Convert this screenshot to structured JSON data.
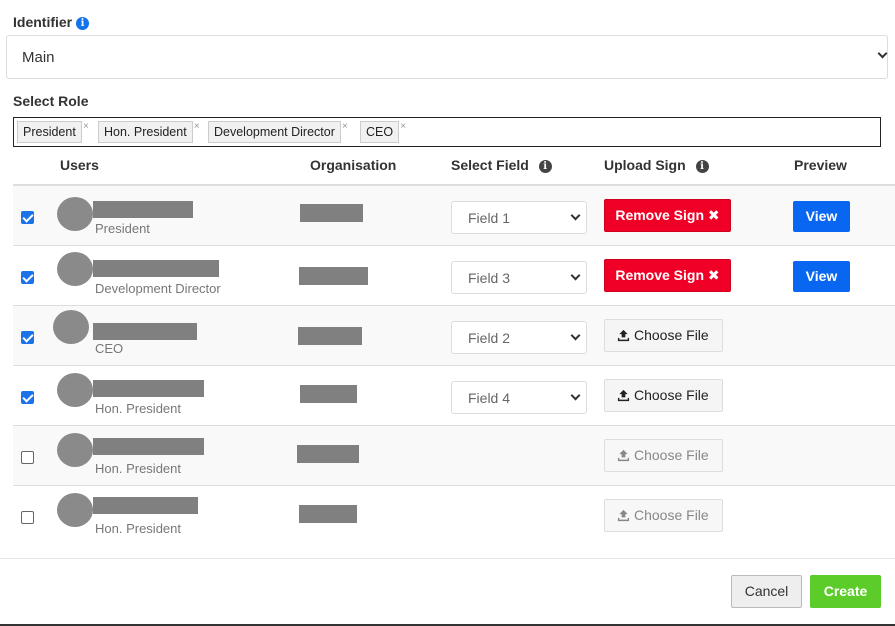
{
  "identifier": {
    "label": "Identifier",
    "info_icon": "info-circle-icon",
    "value": "Main"
  },
  "select_role": {
    "label": "Select Role",
    "tags": [
      "President",
      "Hon. President",
      "Development Director",
      "CEO"
    ],
    "remove_glyph": "×"
  },
  "table": {
    "headers": {
      "users": "Users",
      "organisation": "Organisation",
      "select_field": "Select Field",
      "upload_sign": "Upload Sign",
      "preview": "Preview"
    },
    "rows": [
      {
        "checked": true,
        "role": "President",
        "field": "Field 1",
        "action": "remove",
        "action_label": "Remove Sign",
        "preview": "View"
      },
      {
        "checked": true,
        "role": "Development Director",
        "field": "Field 3",
        "action": "remove",
        "action_label": "Remove Sign",
        "preview": "View"
      },
      {
        "checked": true,
        "role": "CEO",
        "field": "Field 2",
        "action": "choose",
        "action_label": "Choose File",
        "preview": ""
      },
      {
        "checked": true,
        "role": "Hon. President",
        "field": "Field 4",
        "action": "choose",
        "action_label": "Choose File",
        "preview": ""
      },
      {
        "checked": false,
        "role": "Hon. President",
        "field": "",
        "action": "choose-disabled",
        "action_label": "Choose File",
        "preview": ""
      },
      {
        "checked": false,
        "role": "Hon. President",
        "field": "",
        "action": "choose-disabled",
        "action_label": "Choose File",
        "preview": ""
      }
    ]
  },
  "footer": {
    "cancel": "Cancel",
    "create": "Create"
  },
  "colors": {
    "danger": "#f00026",
    "primary": "#0866f0",
    "success": "#5ccc2b",
    "checkbox": "#1a73e8"
  }
}
